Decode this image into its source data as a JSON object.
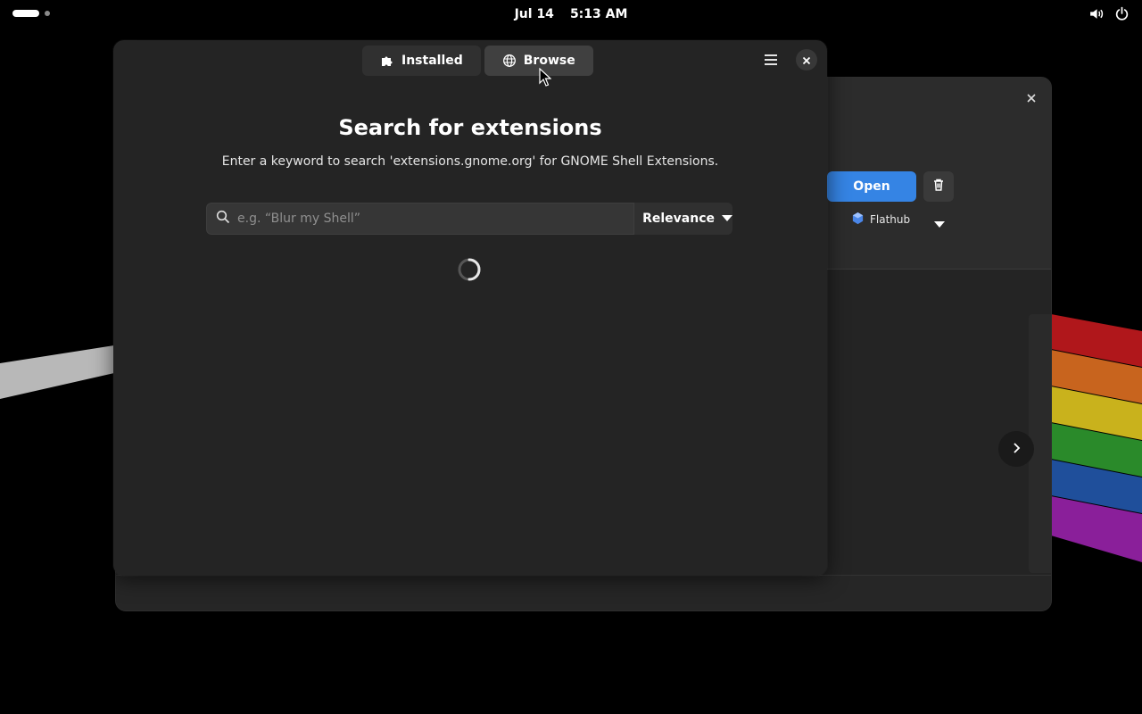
{
  "topbar": {
    "date": "Jul 14",
    "time": "5:13 AM",
    "icons": [
      "volume-icon",
      "power-icon"
    ]
  },
  "background_window": {
    "open_label": "Open",
    "source_label": "Flathub",
    "icons": [
      "close-icon",
      "trash-icon",
      "flathub-icon",
      "dropdown-arrow-icon",
      "chevron-right-icon"
    ]
  },
  "dialog": {
    "tabs": [
      {
        "label": "Installed",
        "icon": "puzzle-icon"
      },
      {
        "label": "Browse",
        "icon": "globe-icon",
        "active": true
      }
    ],
    "title": "Search for extensions",
    "subtitle": "Enter a keyword to search 'extensions.gnome.org' for GNOME Shell Extensions.",
    "search": {
      "placeholder": "e.g. “Blur my Shell”",
      "value": ""
    },
    "sort_label": "Relevance",
    "icons": [
      "menu-icon",
      "close-icon",
      "search-icon",
      "spinner-icon"
    ]
  },
  "colors": {
    "accent": "#3584e4",
    "window_bg": "#242424",
    "header_bg": "#2c2c2c"
  }
}
